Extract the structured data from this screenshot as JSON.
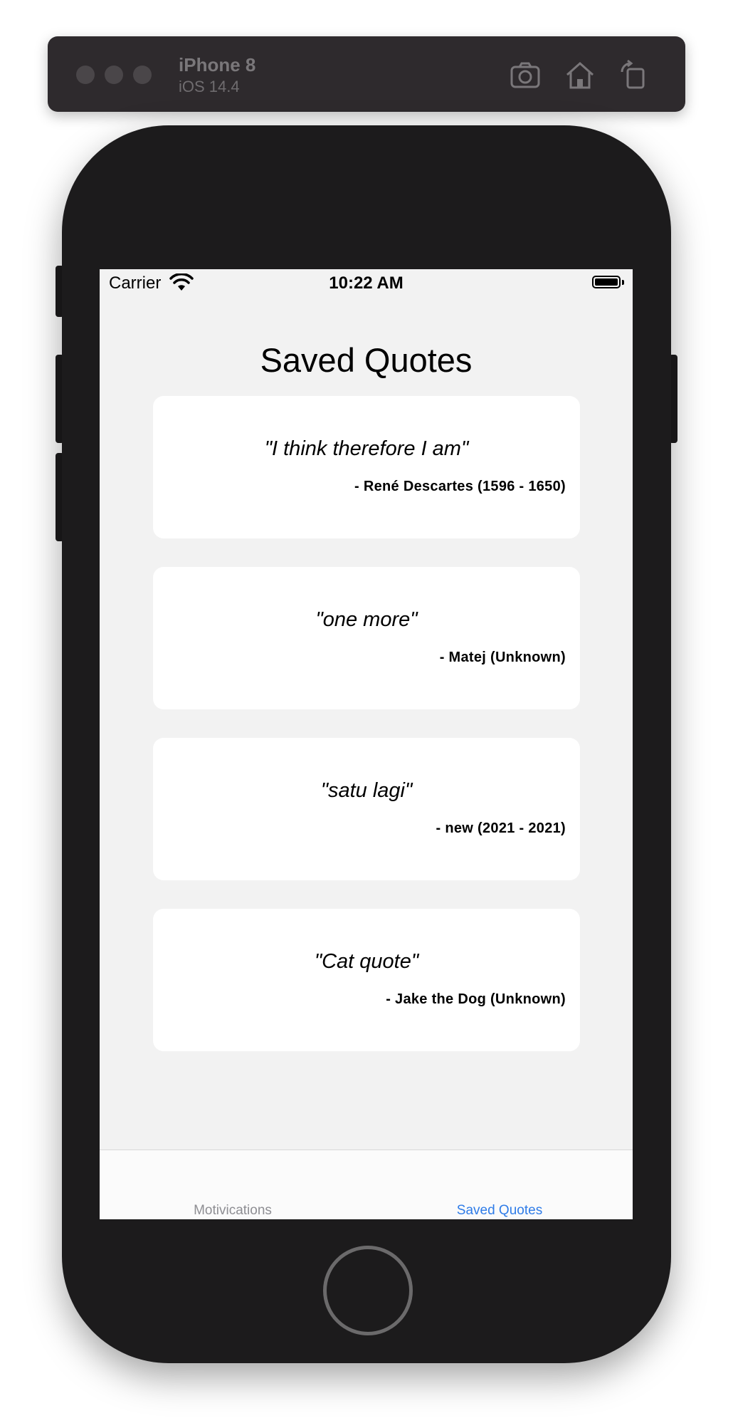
{
  "simulator": {
    "device_name": "iPhone 8",
    "os_version": "iOS 14.4",
    "buttons": [
      "screenshot-icon",
      "home-icon",
      "rotate-icon"
    ]
  },
  "status_bar": {
    "carrier": "Carrier",
    "time": "10:22 AM"
  },
  "page": {
    "title": "Saved Quotes"
  },
  "quotes": [
    {
      "text": "\"I think therefore I am\"",
      "author": "- René Descartes (1596 - 1650)"
    },
    {
      "text": "\"one more\"",
      "author": "- Matej (Unknown)"
    },
    {
      "text": "\"satu lagi\"",
      "author": "- new (2021 - 2021)"
    },
    {
      "text": "\"Cat quote\"",
      "author": "- Jake the Dog (Unknown)"
    }
  ],
  "tab_bar": {
    "tabs": [
      {
        "label": "Motivications",
        "active": false
      },
      {
        "label": "Saved Quotes",
        "active": true
      }
    ],
    "active_color": "#2f7ce8",
    "inactive_color": "#8e8e93"
  }
}
